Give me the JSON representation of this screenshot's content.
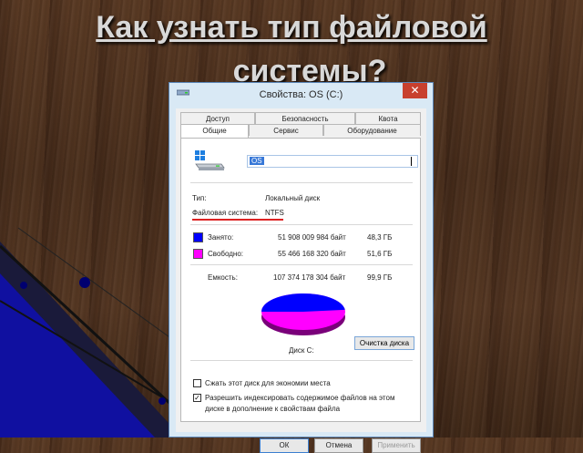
{
  "slide": {
    "title_line1": "Как узнать тип файловой",
    "title_line2": "системы?"
  },
  "window": {
    "title": "Свойства: OS (C:)",
    "close_glyph": "✕"
  },
  "tabs": {
    "row1": [
      "Доступ",
      "Безопасность",
      "Квота"
    ],
    "row2": [
      "Общие",
      "Сервис",
      "Оборудование"
    ],
    "active": "Общие"
  },
  "general": {
    "drive_name": "OS",
    "type_label": "Тип:",
    "type_value": "Локальный диск",
    "fs_label": "Файловая система:",
    "fs_value": "NTFS",
    "used_label": "Занято:",
    "used_bytes": "51 908 009 984 байт",
    "used_size": "48,3 ГБ",
    "free_label": "Свободно:",
    "free_bytes": "55 466 168 320 байт",
    "free_size": "51,6 ГБ",
    "capacity_label": "Емкость:",
    "capacity_bytes": "107 374 178 304 байт",
    "capacity_size": "99,9 ГБ",
    "disk_label": "Диск C:",
    "cleanup_button": "Очистка диска",
    "compress_label": "Сжать этот диск для экономии места",
    "compress_checked": false,
    "index_label_line1": "Разрешить индексировать содержимое файлов на этом",
    "index_label_line2": "диске в дополнение к свойствам файла",
    "index_checked": true
  },
  "colors": {
    "used": "#0000ff",
    "free": "#ff00ff",
    "accent_underline": "#dd2222",
    "close_button": "#c8402e"
  },
  "usage": {
    "used_fraction": 0.483,
    "free_fraction": 0.517
  },
  "buttons": {
    "ok": "ОК",
    "cancel": "Отмена",
    "apply": "Применить"
  },
  "icons": {
    "window_icon": "drive-icon",
    "close": "close-icon",
    "drive": "windows-drive-icon"
  }
}
